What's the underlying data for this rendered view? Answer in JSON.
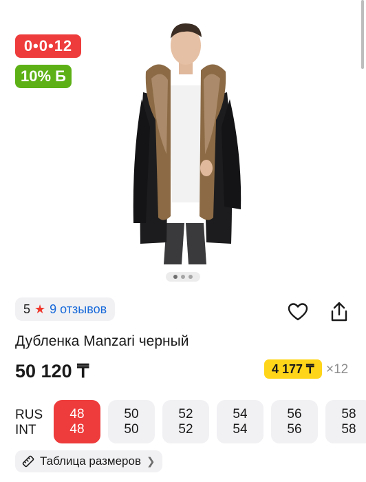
{
  "badges": {
    "timer": "0•0•12",
    "discount": "10% Б"
  },
  "gallery": {
    "pages": 3,
    "active_index": 0
  },
  "rating": {
    "value": "5",
    "reviews_label": "9 отзывов"
  },
  "product": {
    "title": "Дубленка Manzari черный",
    "price": "50 120 ₸"
  },
  "installment": {
    "amount": "4 177 ₸",
    "multiplier": "×12"
  },
  "sizes": {
    "label_rus": "RUS",
    "label_int": "INT",
    "items": [
      {
        "rus": "48",
        "int": "48",
        "selected": true
      },
      {
        "rus": "50",
        "int": "50",
        "selected": false
      },
      {
        "rus": "52",
        "int": "52",
        "selected": false
      },
      {
        "rus": "54",
        "int": "54",
        "selected": false
      },
      {
        "rus": "56",
        "int": "56",
        "selected": false
      },
      {
        "rus": "58",
        "int": "58",
        "selected": false
      }
    ]
  },
  "size_table": {
    "label": "Таблица размеров"
  },
  "icons": {
    "heart": "heart-icon",
    "share": "share-icon",
    "ruler": "ruler-icon",
    "chevron": "chevron-right-icon",
    "star": "star-icon"
  },
  "colors": {
    "red": "#ee3b3b",
    "green": "#5db116",
    "yellow": "#ffd51a",
    "link": "#1769d9"
  }
}
